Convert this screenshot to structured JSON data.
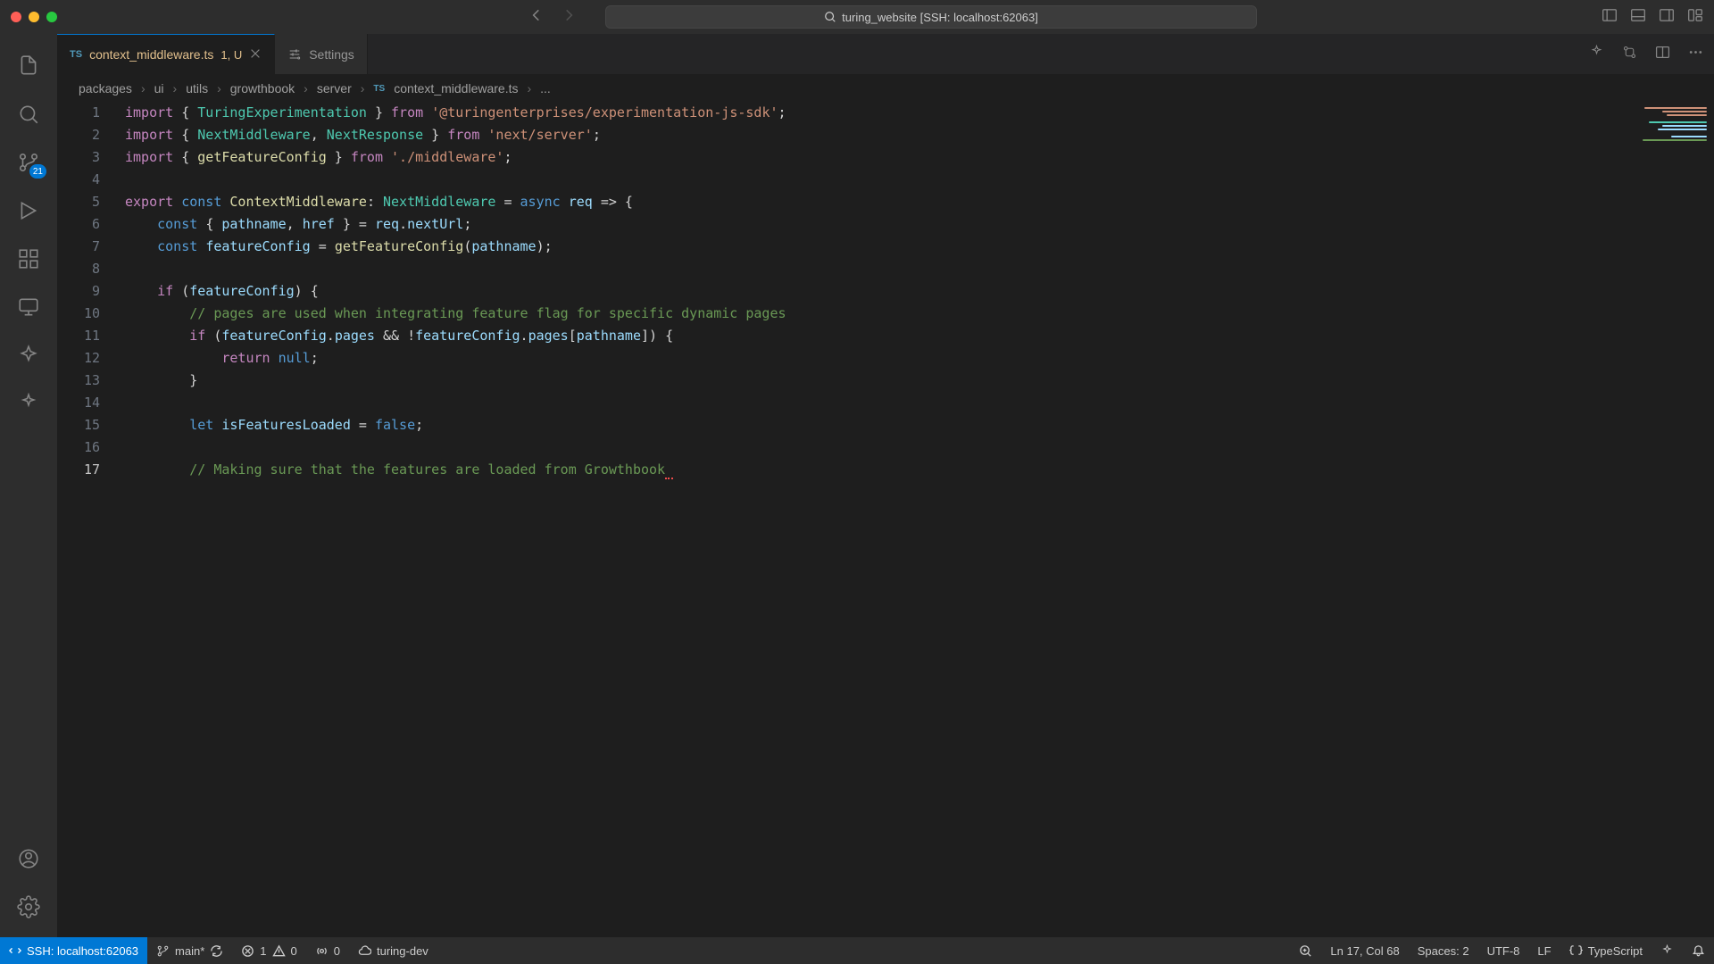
{
  "titlebar": {
    "project": "turing_website [SSH: localhost:62063]"
  },
  "activity": {
    "scm_badge": "21"
  },
  "tabs": {
    "file": {
      "icon": "TS",
      "name": "context_middleware.ts",
      "modified": "1, U"
    },
    "settings": {
      "label": "Settings"
    }
  },
  "breadcrumbs": {
    "p0": "packages",
    "p1": "ui",
    "p2": "utils",
    "p3": "growthbook",
    "p4": "server",
    "file_icon": "TS",
    "file": "context_middleware.ts",
    "tail": "..."
  },
  "code": {
    "lines": {
      "1": {
        "kw": "import",
        "b1": "{ ",
        "t1": "TuringExperimentation",
        "b2": " }",
        "from": "from",
        "str": "'@turingenterprises/experimentation-js-sdk'",
        "semi": ";"
      },
      "2": {
        "kw": "import",
        "b1": "{ ",
        "t1": "NextMiddleware",
        "c": ", ",
        "t2": "NextResponse",
        "b2": " }",
        "from": "from",
        "str": "'next/server'",
        "semi": ";"
      },
      "3": {
        "kw": "import",
        "b1": "{ ",
        "t1": "getFeatureConfig",
        "b2": " }",
        "from": "from",
        "str": "'./middleware'",
        "semi": ";"
      },
      "5": {
        "kw1": "export",
        "kw2": "const",
        "name": "ContextMiddleware",
        "colon": ":",
        "type": "NextMiddleware",
        "eq": " = ",
        "async": "async",
        "param": "req",
        "arrow": " => {",
        "semi": ""
      },
      "6": {
        "kw": "const",
        "b1": "{ ",
        "v1": "pathname",
        "c": ", ",
        "v2": "href",
        "b2": " } = ",
        "obj": "req",
        "dot": ".",
        "prop": "nextUrl",
        "semi": ";"
      },
      "7": {
        "kw": "const",
        "v": "featureConfig",
        "eq": " = ",
        "fn": "getFeatureConfig",
        "p1": "(",
        "arg": "pathname",
        "p2": ")",
        "semi": ";"
      },
      "9": {
        "kw": "if",
        "p1": " (",
        "v": "featureConfig",
        "p2": ") {",
        "semi": ""
      },
      "10": {
        "com": "// pages are used when integrating feature flag for specific dynamic pages"
      },
      "11": {
        "kw": "if",
        "p1": " (",
        "v1": "featureConfig",
        "d1": ".",
        "prop1": "pages",
        "op": " && !",
        "v2": "featureConfig",
        "d2": ".",
        "prop2": "pages",
        "br1": "[",
        "arg": "pathname",
        "br2": "]) {",
        "semi": ""
      },
      "12": {
        "kw": "return",
        "val": "null",
        "semi": ";"
      },
      "13": {
        "brace": "}"
      },
      "15": {
        "kw": "let",
        "v": "isFeaturesLoaded",
        "eq": " = ",
        "val": "false",
        "semi": ";"
      },
      "17": {
        "com": "// Making sure that the features are loaded from Growthbook"
      }
    },
    "numbers": [
      "1",
      "2",
      "3",
      "4",
      "5",
      "6",
      "7",
      "8",
      "9",
      "10",
      "11",
      "12",
      "13",
      "14",
      "15",
      "16",
      "17"
    ]
  },
  "status": {
    "remote": "SSH: localhost:62063",
    "branch": "main*",
    "errors": "1",
    "warnings": "0",
    "ports": "0",
    "env": "turing-dev",
    "cursor": "Ln 17, Col 68",
    "spaces": "Spaces: 2",
    "encoding": "UTF-8",
    "eol": "LF",
    "lang": "TypeScript"
  }
}
